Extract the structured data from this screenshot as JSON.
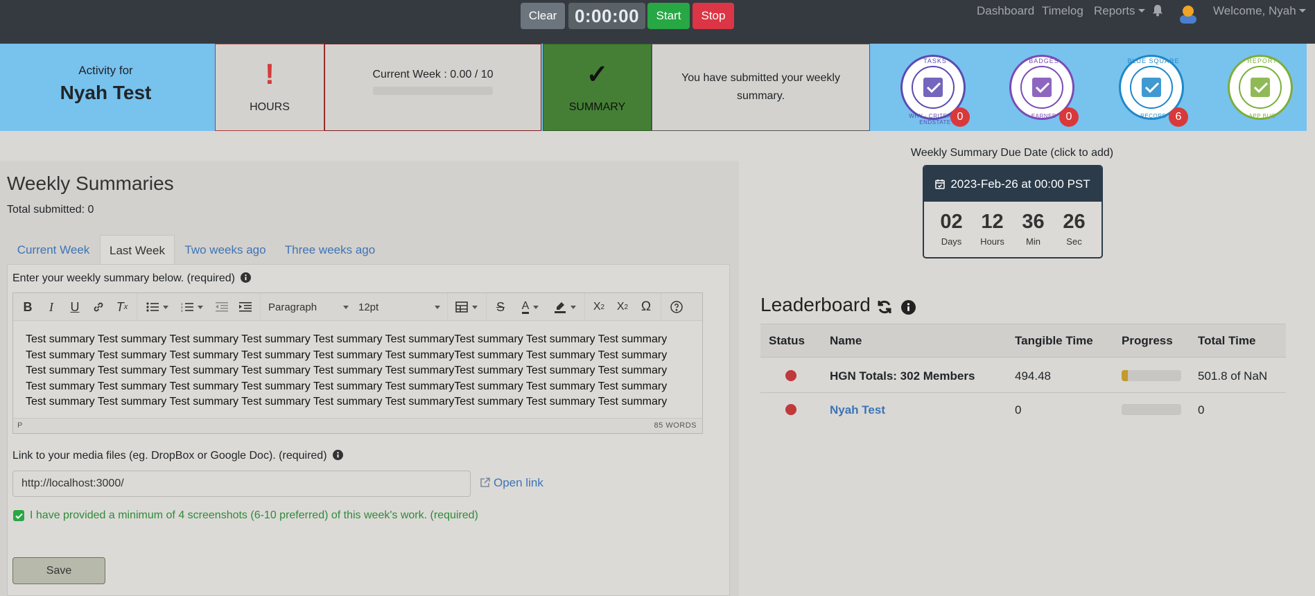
{
  "navbar": {
    "clear_label": "Clear",
    "timer": "0:00:00",
    "start_label": "Start",
    "stop_label": "Stop",
    "links": {
      "dashboard": "Dashboard",
      "timelog": "Timelog",
      "reports": "Reports",
      "welcome": "Welcome, Nyah"
    }
  },
  "header": {
    "activity_for": "Activity for",
    "user_name": "Nyah Test",
    "hours_icon": "!",
    "hours_label": "HOURS",
    "current_week": "Current Week : 0.00 / 10",
    "current_week_progress": 0,
    "summary_icon": "✓",
    "summary_label": "SUMMARY",
    "summary_status": "You have submitted your weekly summary.",
    "badges": [
      {
        "name": "tasks",
        "top": "TASKS",
        "bottom": "WHY · CRITERIA · ENDSTATE",
        "count": "0",
        "color": "#5a4bb0"
      },
      {
        "name": "badges",
        "top": "BADGES",
        "bottom": "EARNED",
        "count": "0",
        "color": "#7a4bb5"
      },
      {
        "name": "blue-square",
        "top": "BLUE SQUARE",
        "bottom": "RECORD",
        "count": "6",
        "color": "#1e88c9"
      },
      {
        "name": "report-bug",
        "top": "REPORT",
        "bottom": "APP BUG",
        "count": "",
        "color": "#7cae3a"
      }
    ]
  },
  "summaries": {
    "title": "Weekly Summaries",
    "total_submitted": "Total submitted: 0",
    "tabs": [
      "Current Week",
      "Last Week",
      "Two weeks ago",
      "Three weeks ago"
    ],
    "active_tab": "Last Week",
    "prompt": "Enter your weekly summary below. (required)",
    "editor": {
      "block_format": "Paragraph",
      "font_size": "12pt",
      "lines": [
        "Test summary Test summary Test summary Test summary Test summary Test summaryTest summary Test summary Test summary",
        "Test summary Test summary Test summary Test summary Test summary Test summaryTest summary Test summary Test summary",
        "Test summary Test summary Test summary Test summary Test summary Test summaryTest summary Test summary Test summary",
        "Test summary Test summary Test summary Test summary Test summary Test summaryTest summary Test summary Test summary",
        "Test summary Test summary Test summary Test summary Test summary Test summaryTest summary Test summary Test summary"
      ],
      "path": "P",
      "word_count": "85 WORDS"
    },
    "media_label": "Link to your media files (eg. DropBox or Google Doc). (required)",
    "media_value": "http://localhost:3000/",
    "open_link": "Open link",
    "screenshots_label": "I have provided a minimum of 4 screenshots (6-10 preferred) of this week's work. (required)",
    "screenshots_checked": true,
    "save_label": "Save"
  },
  "due": {
    "label": "Weekly Summary Due Date (click to add)",
    "date": "2023-Feb-26 at 00:00 PST",
    "countdown": [
      {
        "value": "02",
        "unit": "Days"
      },
      {
        "value": "12",
        "unit": "Hours"
      },
      {
        "value": "36",
        "unit": "Min"
      },
      {
        "value": "26",
        "unit": "Sec"
      }
    ]
  },
  "leaderboard": {
    "title": "Leaderboard",
    "columns": [
      "Status",
      "Name",
      "Tangible Time",
      "Progress",
      "Total Time"
    ],
    "rows": [
      {
        "name": "HGN Totals: 302 Members",
        "tangible": "494.48",
        "progress": 0.1,
        "total": "501.8 of NaN",
        "link": false
      },
      {
        "name": "Nyah Test",
        "tangible": "0",
        "progress": 0,
        "total": "0",
        "link": true
      }
    ]
  },
  "colors": {
    "navbar": "#353a40",
    "strip": "#78c2ee",
    "summary_panel": "#447f35",
    "link": "#3d74b6",
    "checkbox_text": "#2e8b3a"
  }
}
